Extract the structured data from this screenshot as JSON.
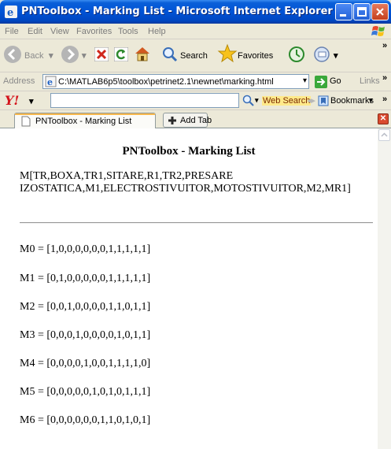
{
  "window": {
    "title": "PNToolbox - Marking List - Microsoft Internet Explorer"
  },
  "menu": [
    "File",
    "Edit",
    "View",
    "Favorites",
    "Tools",
    "Help"
  ],
  "toolbar": {
    "back_label": "Back",
    "search_label": "Search",
    "favorites_label": "Favorites"
  },
  "address": {
    "label": "Address",
    "url": "C:\\MATLAB6p5\\toolbox\\petrinet2.1\\newnet\\marking.html",
    "go_label": "Go",
    "links_label": "Links"
  },
  "yahoo": {
    "logo": "Y!",
    "web_search_label": "Web Search",
    "bookmarks_label": "Bookmarks"
  },
  "tabs": {
    "active_label": "PNToolbox - Marking List",
    "add_tab_label": "Add Tab"
  },
  "page": {
    "title": "PNToolbox - Marking List",
    "header_line1": "M[TR,BOXA,TR1,SITARE,R1,TR2,PRESARE",
    "header_line2": "IZOSTATICA,M1,ELECTROSTIVUITOR,MOTOSTIVUITOR,M2,MR1]",
    "markings": [
      "M0 = [1,0,0,0,0,0,0,1,1,1,1,1]",
      "M1 = [0,1,0,0,0,0,0,1,1,1,1,1]",
      "M2 = [0,0,1,0,0,0,0,1,1,0,1,1]",
      "M3 = [0,0,0,1,0,0,0,0,1,0,1,1]",
      "M4 = [0,0,0,0,1,0,0,1,1,1,1,0]",
      "M5 = [0,0,0,0,0,1,0,1,0,1,1,1]",
      "M6 = [0,0,0,0,0,0,1,1,0,1,0,1]"
    ]
  }
}
